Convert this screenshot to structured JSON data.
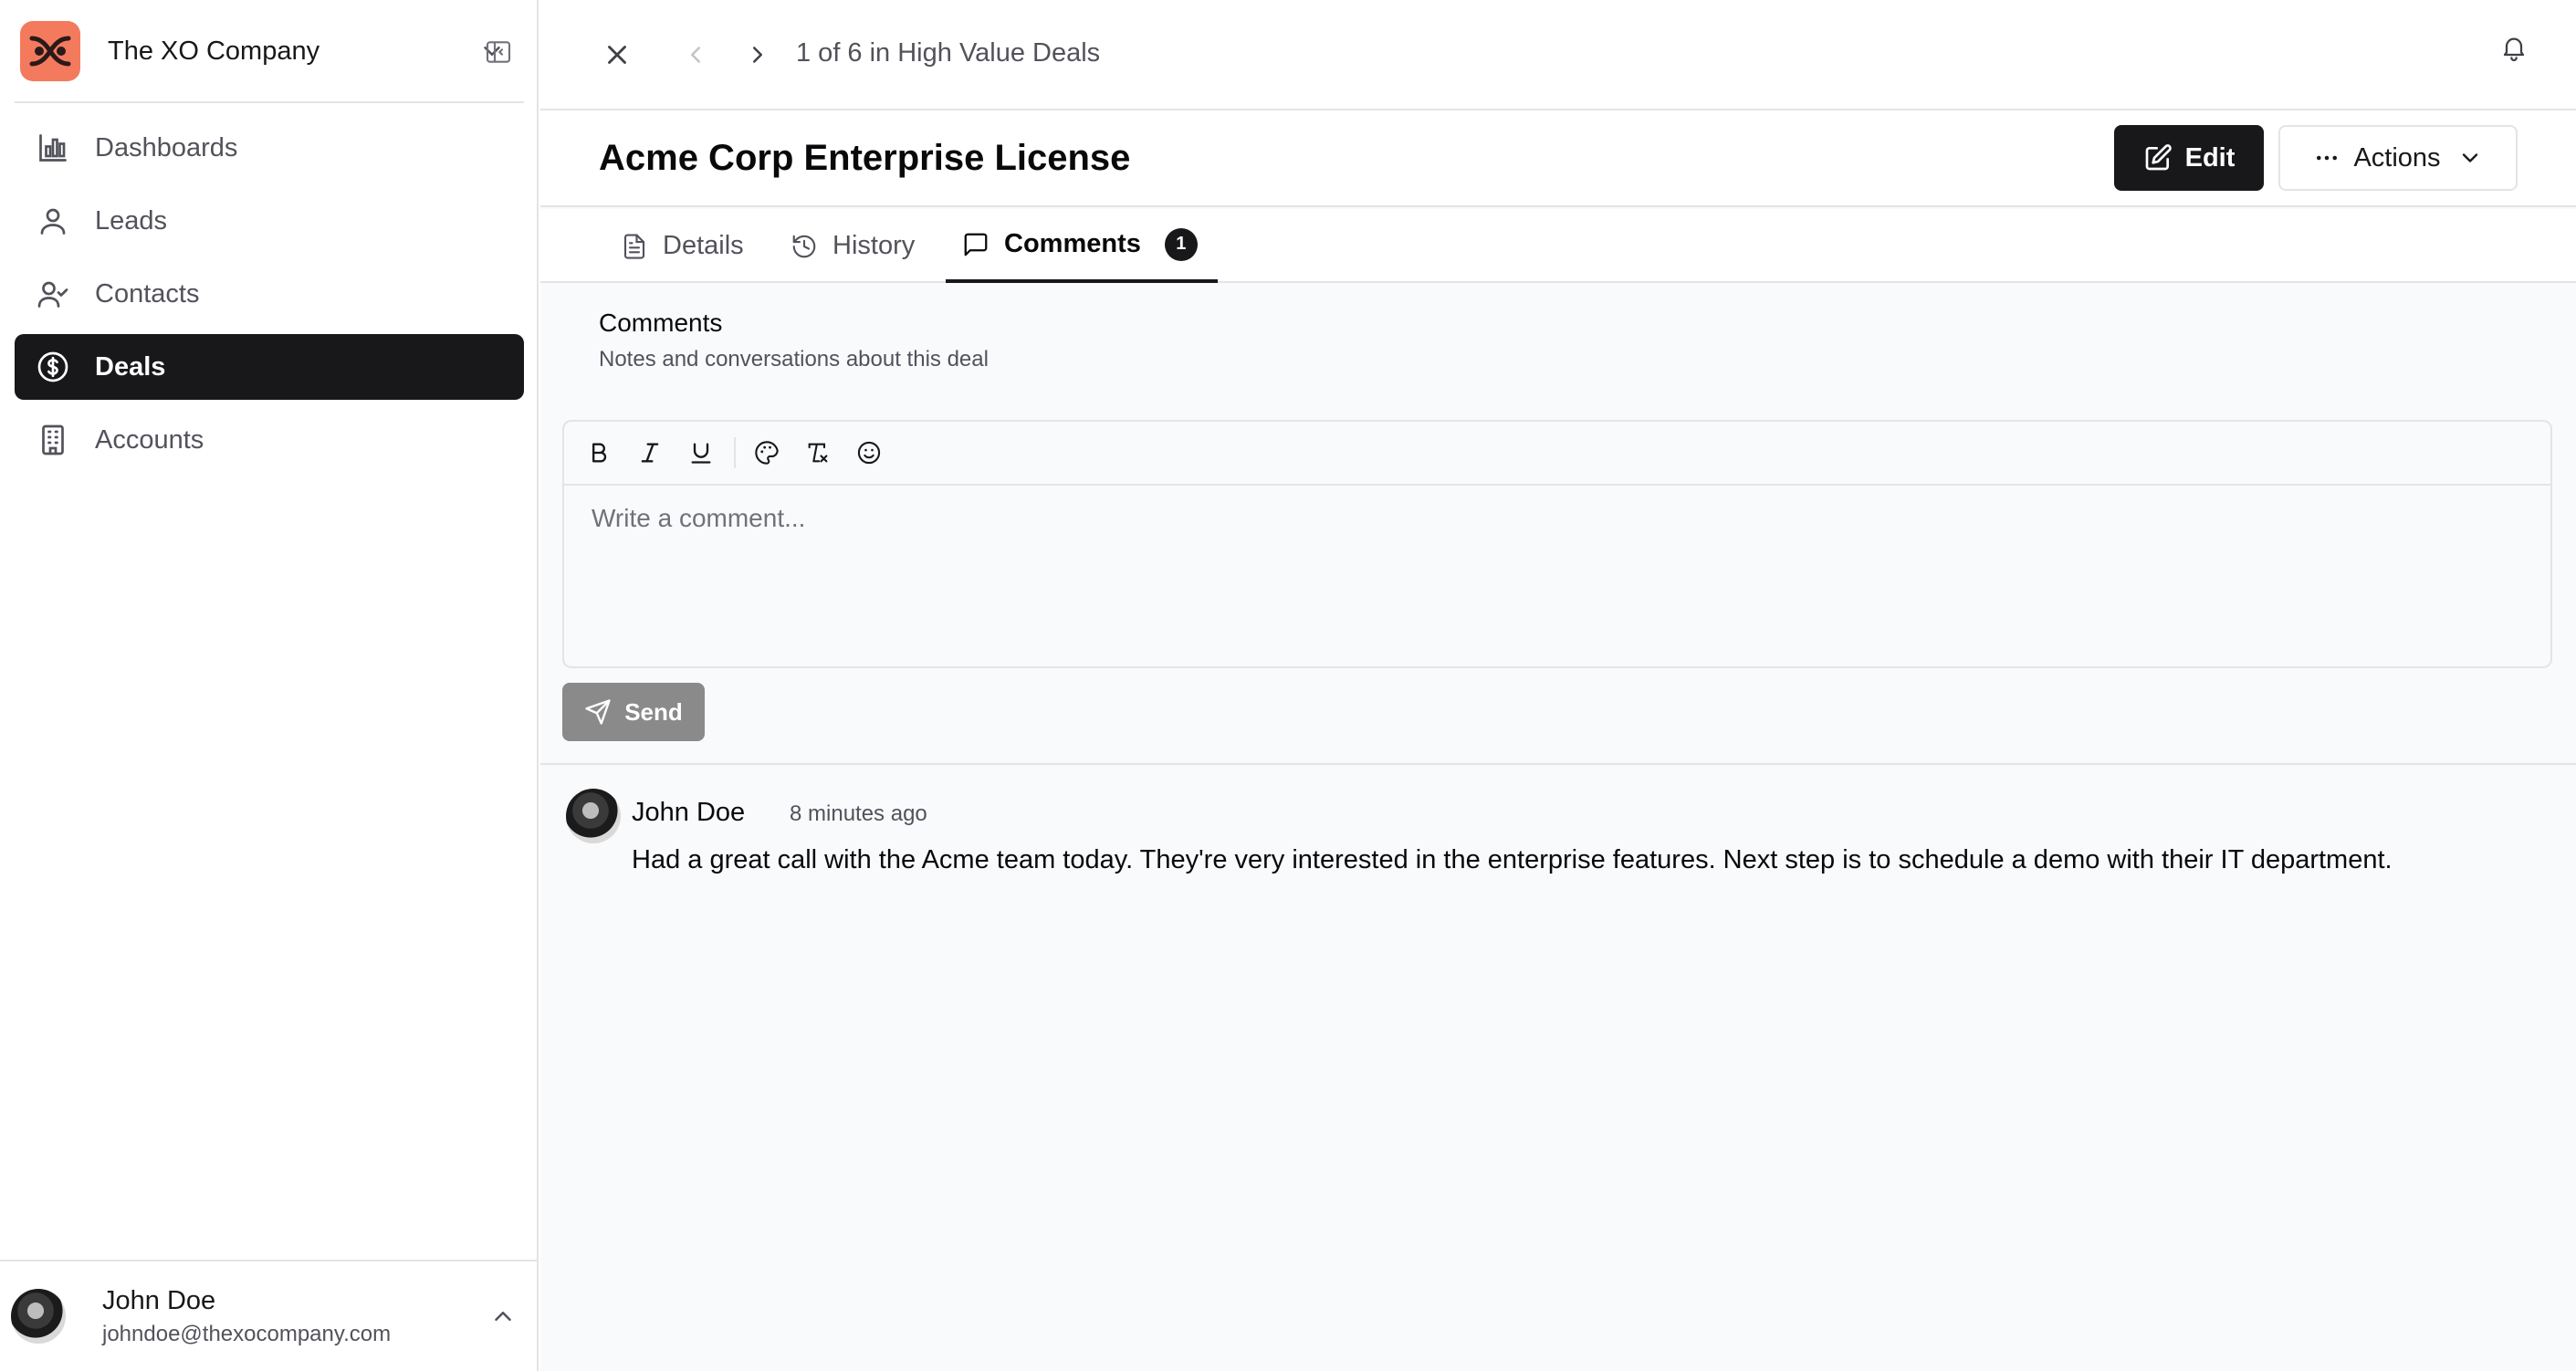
{
  "sidebar": {
    "org_name": "The XO Company",
    "nav": [
      {
        "label": "Dashboards",
        "icon": "chart-icon"
      },
      {
        "label": "Leads",
        "icon": "user-icon"
      },
      {
        "label": "Contacts",
        "icon": "user-check-icon"
      },
      {
        "label": "Deals",
        "icon": "dollar-circle-icon",
        "active": true
      },
      {
        "label": "Accounts",
        "icon": "building-icon"
      }
    ],
    "user": {
      "name": "John Doe",
      "email": "johndoe@thexocompany.com"
    }
  },
  "topbar": {
    "pager_text": "1 of 6 in High Value Deals"
  },
  "deal": {
    "title": "Acme Corp Enterprise License",
    "edit_label": "Edit",
    "actions_label": "Actions"
  },
  "tabs": [
    {
      "label": "Details"
    },
    {
      "label": "History"
    },
    {
      "label": "Comments",
      "badge": "1",
      "active": true
    }
  ],
  "comments_section": {
    "title": "Comments",
    "subtitle": "Notes and conversations about this deal",
    "editor_placeholder": "Write a comment...",
    "send_label": "Send",
    "items": [
      {
        "author": "John Doe",
        "time": "8 minutes ago",
        "text": "Had a great call with the Acme team today. They're very interested in the enterprise features. Next step is to schedule a demo with their IT department."
      }
    ]
  },
  "colors": {
    "accent": "#18181b",
    "logo_bg": "#f47a5e",
    "send_disabled": "#8a8a8a",
    "border": "#e4e4e7"
  }
}
